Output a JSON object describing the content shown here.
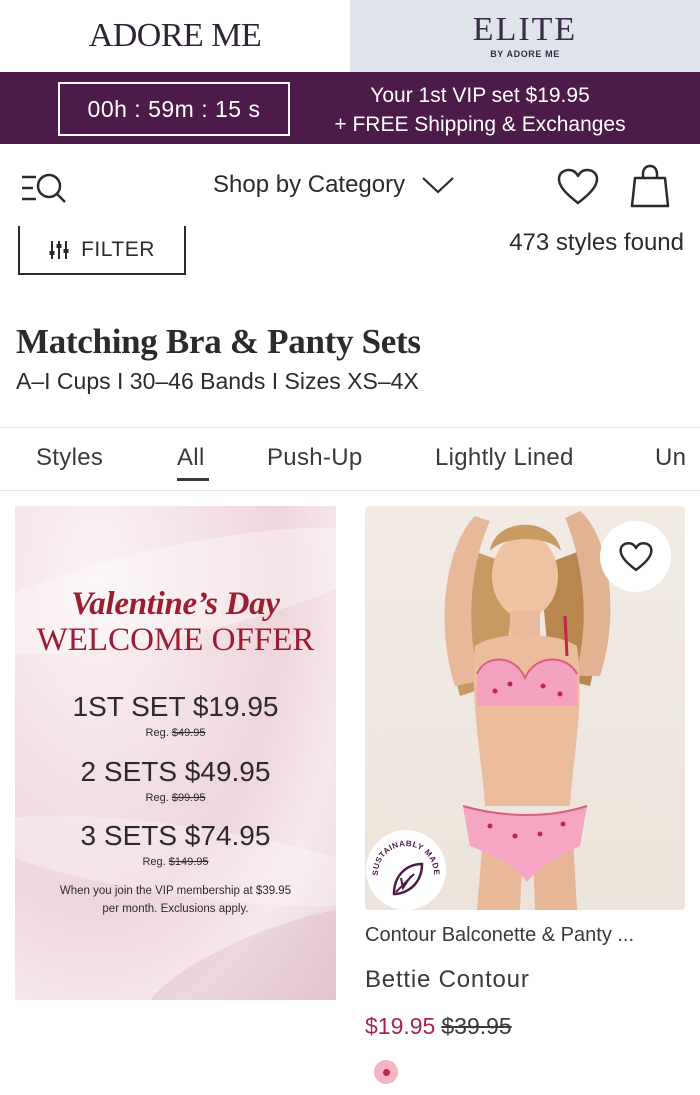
{
  "brands": {
    "adore": "ADORE ME",
    "elite": "ELITE",
    "elite_sub": "BY ADORE ME"
  },
  "promo": {
    "timer": "00h : 59m : 15 s",
    "line1": "Your 1st VIP set $19.95",
    "line2": "+ FREE Shipping & Exchanges"
  },
  "nav": {
    "shop_by_category": "Shop by Category"
  },
  "filter": {
    "label": "FILTER",
    "styles_found": "473 styles found"
  },
  "page": {
    "title": "Matching Bra & Panty Sets",
    "subtitle": "A–I Cups I 30–46 Bands I Sizes XS–4X"
  },
  "tabs": [
    "Styles",
    "All",
    "Push-Up",
    "Lightly Lined",
    "Un"
  ],
  "active_tab": "All",
  "offer_card": {
    "title_script": "Valentine’s Day",
    "title_main": "WELCOME OFFER",
    "lines": [
      {
        "text": "1ST SET $19.95",
        "reg_label": "Reg.",
        "reg_price": "$49.95"
      },
      {
        "text": "2 SETS $49.95",
        "reg_label": "Reg.",
        "reg_price": "$99.95"
      },
      {
        "text": "3 SETS $74.95",
        "reg_label": "Reg.",
        "reg_price": "$149.95"
      }
    ],
    "note": "When you join the VIP membership at $39.95 per month. Exclusions apply."
  },
  "product": {
    "category": "Contour Balconette & Panty ...",
    "name": "Bettie Contour",
    "sale_price": "$19.95",
    "reg_price": "$39.95",
    "badge": "SUSTAINABLY MADE"
  },
  "colors": {
    "brand_purple": "#4d1b49",
    "elite_bg": "#dfe3ea",
    "accent_red": "#9c1c30",
    "sale_price": "#a7254a"
  }
}
